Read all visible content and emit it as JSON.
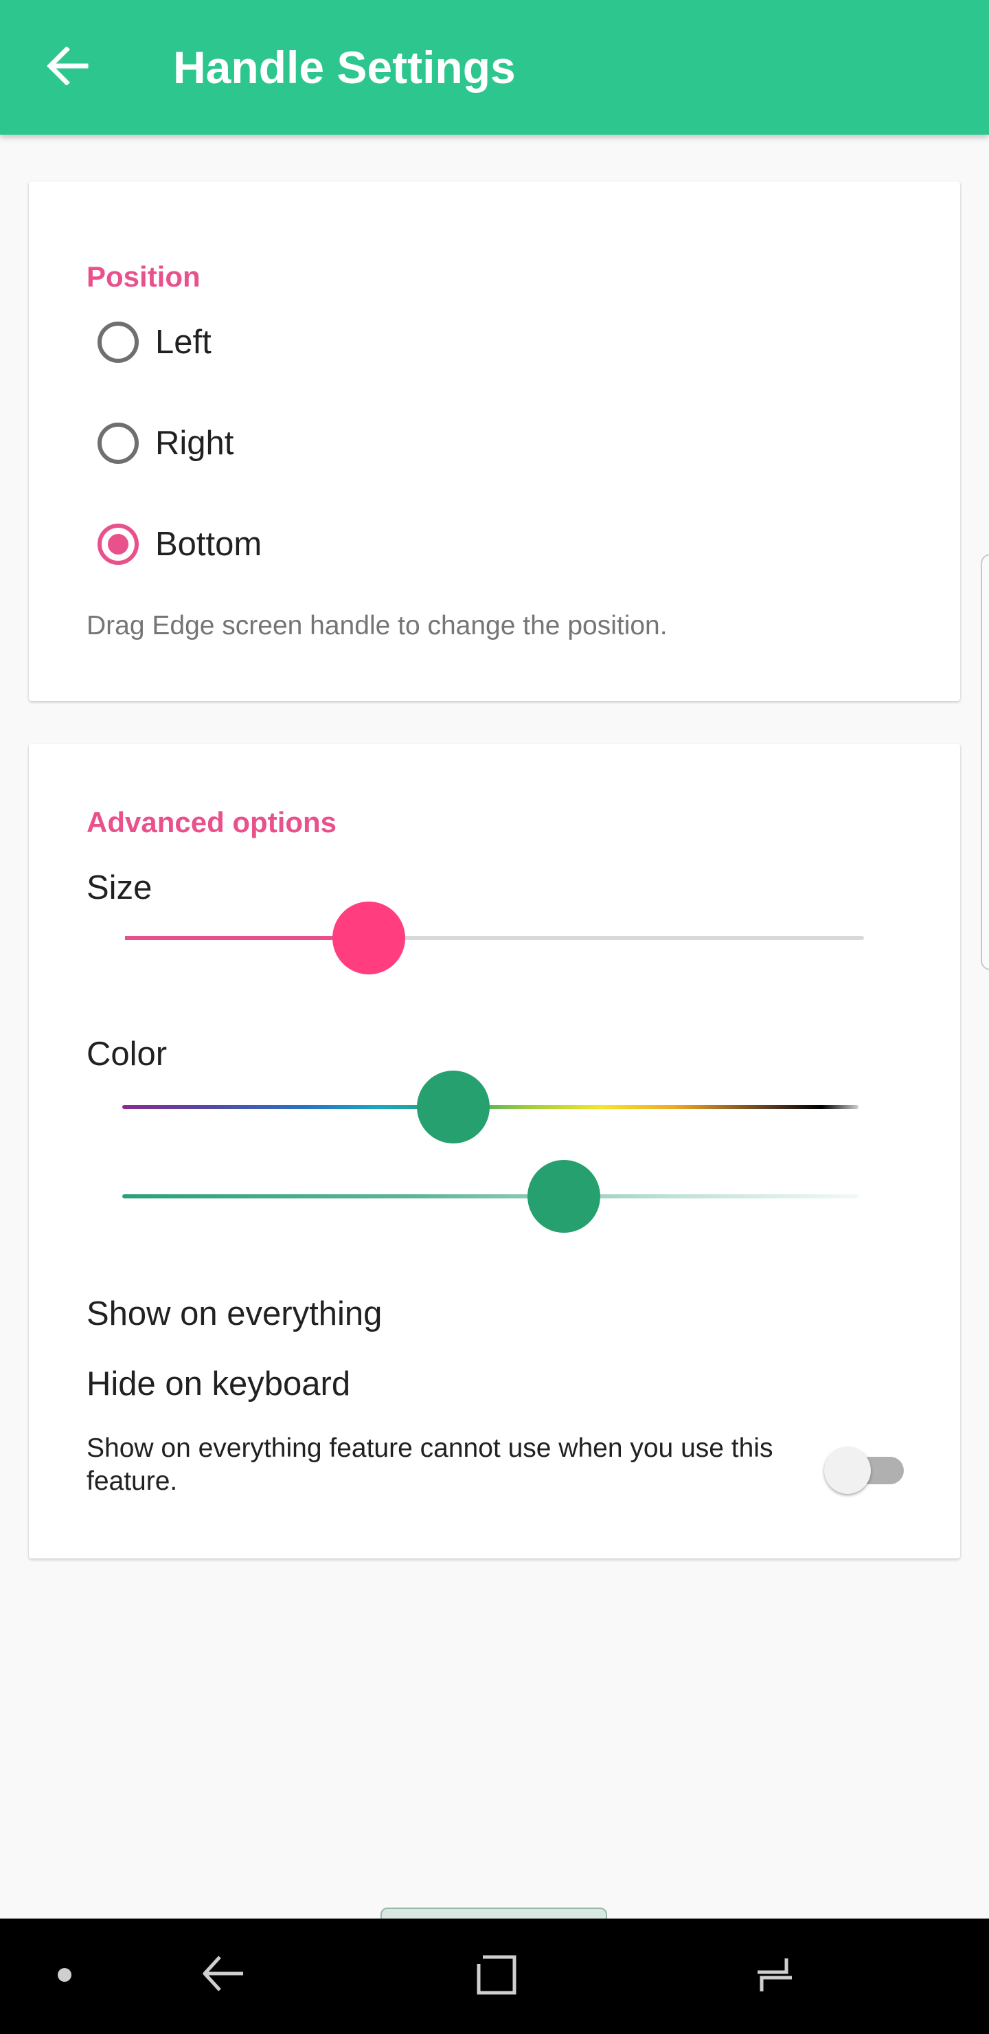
{
  "app_bar": {
    "title": "Handle Settings",
    "back_icon": "arrow-back-icon",
    "background_color": "#2dc68f"
  },
  "position_card": {
    "header": "Position",
    "options": [
      {
        "label": "Left",
        "checked": false
      },
      {
        "label": "Right",
        "checked": false
      },
      {
        "label": "Bottom",
        "checked": true
      }
    ],
    "helper_text": "Drag Edge screen handle to change the position."
  },
  "advanced_card": {
    "header": "Advanced options",
    "size": {
      "label": "Size",
      "value_fraction": 0.33,
      "accent_color": "#ff3d7f"
    },
    "color": {
      "label": "Color",
      "hue_fraction": 0.45,
      "alpha_fraction": 0.6,
      "selected_color": "#26a06f"
    },
    "show_on_everything": {
      "label": "Show on everything"
    },
    "hide_on_keyboard": {
      "label": "Hide on keyboard",
      "description": "Show on everything feature cannot use when you use this feature.",
      "enabled": false
    }
  },
  "colors": {
    "accent": "#e8518c",
    "primary": "#2dc68f"
  },
  "nav_bar": {
    "icons": [
      "dot-icon",
      "back-icon",
      "recents-icon",
      "home-icon"
    ]
  }
}
